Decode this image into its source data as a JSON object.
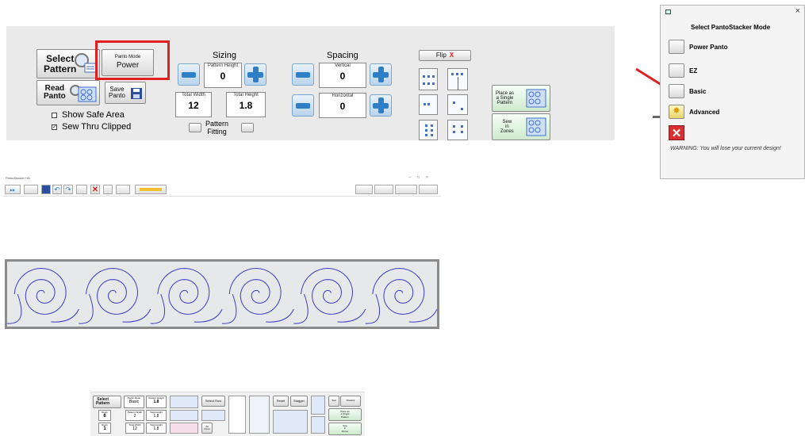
{
  "top_panel": {
    "select_pattern": "Select\nPattern",
    "read_panto": "Read\nPanto",
    "panto_mode_label": "Panto Mode",
    "panto_mode_value": "Power",
    "save_panto": "Save\nPanto",
    "show_safe_area": "Show Safe Area",
    "sew_thru_clipped": "Sew Thru Clipped",
    "sizing_title": "Sizing",
    "pattern_height_label": "Pattern Height",
    "pattern_height_value": "0",
    "total_width_label": "Total Width",
    "total_width_value": "12",
    "total_height_label": "Total Height",
    "total_height_value": "1.8",
    "pattern_fitting": "Pattern\nFitting",
    "spacing_title": "Spacing",
    "vertical_label": "Vertical",
    "vertical_value": "0",
    "horizontal_label": "Horizontal",
    "horizontal_value": "0",
    "flip_label": "Flip",
    "flip_x": "X",
    "place_single": "Place as\na Single\nPattern",
    "sew_zones": "Sew\nin\nZones",
    "colors": {
      "highlight_red": "#e02020",
      "panel_bg": "#eaeaea",
      "accent_blue": "#2f7fc7"
    }
  },
  "mode_dialog": {
    "title": "Select PantoStacker Mode",
    "close": "×",
    "options": [
      "Power Panto",
      "EZ",
      "Basic",
      "Advanced"
    ],
    "warning": "WARNING: You will lose your current design!"
  },
  "app_window": {
    "title": "PantoStacker HD",
    "window_controls": [
      "–",
      "□",
      "×"
    ],
    "canvas_bg": "#e6e8ea",
    "pattern_color": "#3b3bc4",
    "pattern_repeats": 6
  },
  "bottom_panel": {
    "select_pattern": "Select\nPattern",
    "panto_mode_label": "Panto Mode",
    "panto_mode_value": "Basic",
    "pattern_height_label": "Pattern Height",
    "pattern_height_value": "1.8",
    "rows_label": "Rows",
    "rows_value": "6",
    "rows2_label": "Rows",
    "rows2_value": "1",
    "pattern_width_label": "Pattern Width",
    "pattern_width_value": "2",
    "total_height_label": "Total Height",
    "total_height_value": "1.8",
    "total_width_label": "Total Width",
    "total_width_value": "12",
    "total_height2_value": "1.8",
    "select_row": "Select Row",
    "reset": "Reset",
    "stagger": "Stagger",
    "tear": "Tear",
    "shadow": "Shadow",
    "all_none": "All\nNone",
    "place_single": "Place as\na Single\nPattern",
    "sew_zones": "Sew\nin\nZones"
  }
}
